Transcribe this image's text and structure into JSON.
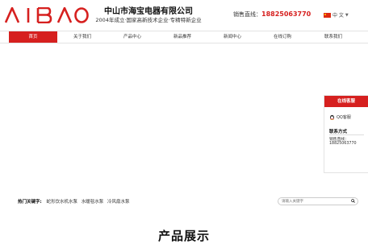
{
  "header": {
    "logo_text": "AIBAO",
    "company_name": "中山市海宝电器有限公司",
    "slogan": "2004年成立·国家高新技术企业·专精特新企业",
    "hotline_label": "销售直线：",
    "hotline_number": "18825063770",
    "language": "中 文",
    "brand_color": "#d6201f"
  },
  "nav": {
    "items": [
      {
        "label": "首页",
        "active": true
      },
      {
        "label": "关于我们"
      },
      {
        "label": "产品中心"
      },
      {
        "label": "新品推荐"
      },
      {
        "label": "新闻中心"
      },
      {
        "label": "在线订购"
      },
      {
        "label": "联系我们"
      }
    ]
  },
  "hot": {
    "label": "热门关键字:",
    "keywords": [
      "蛇形饮水机水泵",
      "水暖毯水泵",
      "冷风扇水泵"
    ]
  },
  "search": {
    "placeholder": "请输入关键字"
  },
  "section": {
    "title": "产品展示"
  },
  "side": {
    "title": "在线客服",
    "qq_label": "QQ客服",
    "contact_title": "联系方式",
    "phone_label": "销售直线：",
    "phone": "18825063770"
  }
}
